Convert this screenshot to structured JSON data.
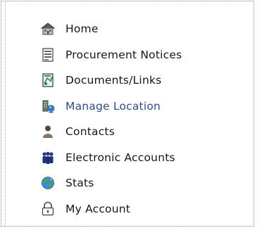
{
  "nav": {
    "items": [
      {
        "label": "Home",
        "icon": "home-icon"
      },
      {
        "label": "Procurement Notices",
        "icon": "notice-document-icon"
      },
      {
        "label": "Documents/Links",
        "icon": "document-link-icon"
      },
      {
        "label": "Manage Location",
        "icon": "location-pin-icon",
        "active": true
      },
      {
        "label": "Contacts",
        "icon": "contact-person-icon"
      },
      {
        "label": "Electronic Accounts",
        "icon": "user-group-icon"
      },
      {
        "label": "Stats",
        "icon": "globe-icon"
      },
      {
        "label": "My Account",
        "icon": "lock-account-icon"
      }
    ]
  },
  "colors": {
    "text": "#161616",
    "active_text": "#2f4e83",
    "border": "#8a8a8a"
  }
}
